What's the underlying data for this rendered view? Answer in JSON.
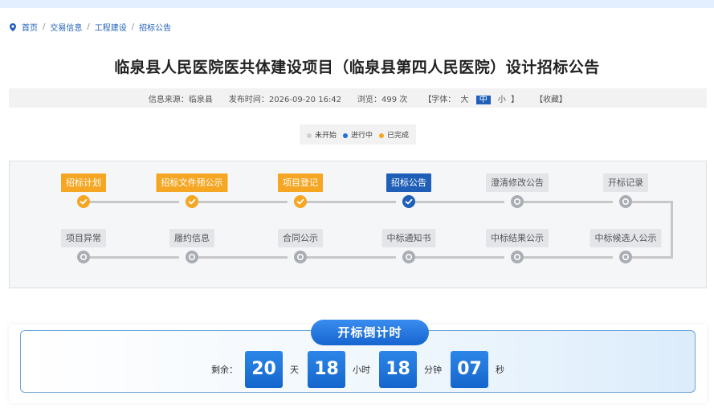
{
  "breadcrumb": [
    "首页",
    "交易信息",
    "工程建设",
    "招标公告"
  ],
  "title": "临泉县人民医院医共体建设项目（临泉县第四人民医院）设计招标公告",
  "info": {
    "source": "信息来源：临泉县",
    "publish_time": "发布时间：2026-09-20 16:42",
    "views": "浏览：499 次",
    "font_open": "【字体：",
    "font_large": "大",
    "font_medium": "中",
    "font_small": "小",
    "font_close": "】",
    "favorite": "【收藏】"
  },
  "legend": [
    {
      "label": "未开始",
      "color": "#d0d0d0"
    },
    {
      "label": "进行中",
      "color": "#1f6fe0"
    },
    {
      "label": "已完成",
      "color": "#f5a623"
    }
  ],
  "steps_row1": [
    {
      "label": "招标计划",
      "status": "done"
    },
    {
      "label": "招标文件预公示",
      "status": "done"
    },
    {
      "label": "项目登记",
      "status": "done"
    },
    {
      "label": "招标公告",
      "status": "current"
    },
    {
      "label": "澄清修改公告",
      "status": "pending"
    },
    {
      "label": "开标记录",
      "status": "pending"
    }
  ],
  "steps_row2": [
    {
      "label": "项目异常",
      "status": "pending"
    },
    {
      "label": "履约信息",
      "status": "pending"
    },
    {
      "label": "合同公示",
      "status": "pending"
    },
    {
      "label": "中标通知书",
      "status": "pending"
    },
    {
      "label": "中标结果公示",
      "status": "pending"
    },
    {
      "label": "中标候选人公示",
      "status": "pending"
    }
  ],
  "countdown": {
    "title": "开标倒计时",
    "prefix": "剩余：",
    "days": "20",
    "days_unit": "天",
    "hours": "18",
    "hours_unit": "小时",
    "minutes": "18",
    "minutes_unit": "分钟",
    "seconds": "07",
    "seconds_unit": "秒"
  },
  "colors": {
    "accent": "#1f5fb8",
    "done": "#f5a623",
    "pending": "#a9adb4"
  }
}
